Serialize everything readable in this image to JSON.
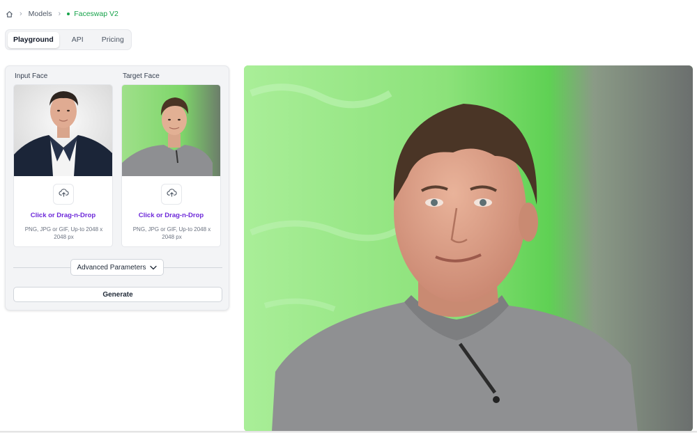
{
  "breadcrumb": {
    "home_icon": "home-icon",
    "models": "Models",
    "current": "Faceswap V2"
  },
  "tabs": [
    {
      "label": "Playground",
      "active": true
    },
    {
      "label": "API",
      "active": false
    },
    {
      "label": "Pricing",
      "active": false
    }
  ],
  "inputs": {
    "input_face": {
      "label": "Input Face",
      "upload_icon": "cloud-upload-icon",
      "drop_text": "Click or Drag-n-Drop",
      "hint": "PNG, JPG or GIF, Up-to 2048 x 2048 px"
    },
    "target_face": {
      "label": "Target Face",
      "upload_icon": "cloud-upload-icon",
      "drop_text": "Click or Drag-n-Drop",
      "hint": "PNG, JPG or GIF, Up-to 2048 x 2048 px"
    }
  },
  "advanced": {
    "label": "Advanced Parameters",
    "icon": "chevron-down-icon"
  },
  "generate": {
    "label": "Generate"
  },
  "colors": {
    "accent_green": "#16a34a",
    "link_purple": "#6d28d9",
    "result_bg": "#7ee06a"
  }
}
